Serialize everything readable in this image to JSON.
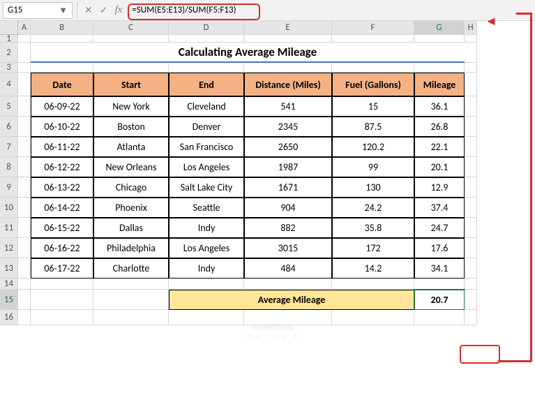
{
  "toolbar": {
    "namebox_value": "G15",
    "formula": "=SUM(E5:E13)/SUM(F5:F13)"
  },
  "cols": [
    "A",
    "B",
    "C",
    "D",
    "E",
    "F",
    "G",
    "H"
  ],
  "rows": [
    "1",
    "2",
    "3",
    "4",
    "5",
    "6",
    "7",
    "8",
    "9",
    "10",
    "11",
    "12",
    "13",
    "14",
    "15",
    "16"
  ],
  "title": "Calculating Average Mileage",
  "headers": {
    "date": "Date",
    "start": "Start",
    "end": "End",
    "distance": "Distance (Miles)",
    "fuel": "Fuel (Gallons)",
    "mileage": "Mileage"
  },
  "avg_label": "Average Mileage",
  "avg_value": "20.7",
  "watermark": {
    "main": "exceldemy",
    "sub": "EXCEL · DATA · BI"
  },
  "chart_data": {
    "type": "table",
    "title": "Calculating Average Mileage",
    "columns": [
      "Date",
      "Start",
      "End",
      "Distance (Miles)",
      "Fuel (Gallons)",
      "Mileage"
    ],
    "rows": [
      [
        "06-09-22",
        "New York",
        "Cleveland",
        541,
        15,
        36.1
      ],
      [
        "06-10-22",
        "Boston",
        "Denver",
        2345,
        87.5,
        26.8
      ],
      [
        "06-11-22",
        "Atlanta",
        "San Francisco",
        2650,
        120.2,
        22.1
      ],
      [
        "06-12-22",
        "New Orleans",
        "Los Angeles",
        1987,
        99,
        20.1
      ],
      [
        "06-13-22",
        "Chicago",
        "Salt Lake City",
        1671,
        130,
        12.9
      ],
      [
        "06-14-22",
        "Phoenix",
        "Seattle",
        904,
        24.2,
        37.4
      ],
      [
        "06-15-22",
        "Dallas",
        "Indy",
        882,
        35.8,
        24.7
      ],
      [
        "06-16-22",
        "Philadelphia",
        "Los Angeles",
        3015,
        172,
        17.6
      ],
      [
        "06-17-22",
        "Charlotte",
        "Indy",
        484,
        14.2,
        34.1
      ]
    ],
    "summary": {
      "label": "Average Mileage",
      "value": 20.7
    }
  }
}
